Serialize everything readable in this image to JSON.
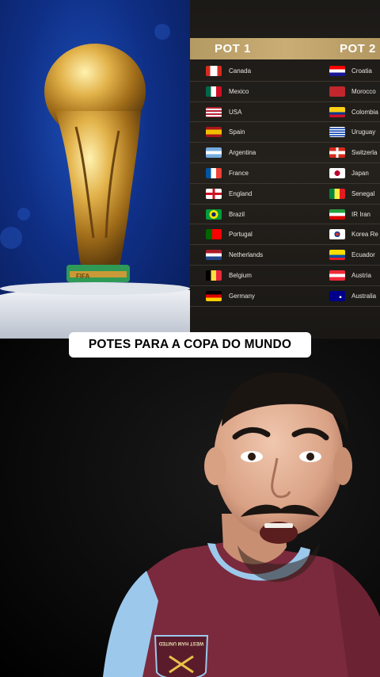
{
  "caption": "POTES PARA A COPA DO MUNDO",
  "pots": {
    "pot1_title": "POT 1",
    "pot2_title": "POT 2",
    "pot1": [
      {
        "name": "Canada",
        "flag": "canada-flag-icon"
      },
      {
        "name": "Mexico",
        "flag": "mexico-flag-icon"
      },
      {
        "name": "USA",
        "flag": "usa-flag-icon"
      },
      {
        "name": "Spain",
        "flag": "spain-flag-icon"
      },
      {
        "name": "Argentina",
        "flag": "argentina-flag-icon"
      },
      {
        "name": "France",
        "flag": "france-flag-icon"
      },
      {
        "name": "England",
        "flag": "england-flag-icon"
      },
      {
        "name": "Brazil",
        "flag": "brazil-flag-icon"
      },
      {
        "name": "Portugal",
        "flag": "portugal-flag-icon"
      },
      {
        "name": "Netherlands",
        "flag": "netherlands-flag-icon"
      },
      {
        "name": "Belgium",
        "flag": "belgium-flag-icon"
      },
      {
        "name": "Germany",
        "flag": "germany-flag-icon"
      }
    ],
    "pot2": [
      {
        "name": "Croatia",
        "flag": "croatia-flag-icon"
      },
      {
        "name": "Morocco",
        "flag": "morocco-flag-icon"
      },
      {
        "name": "Colombia",
        "flag": "colombia-flag-icon"
      },
      {
        "name": "Uruguay",
        "flag": "uruguay-flag-icon"
      },
      {
        "name": "Switzerla",
        "flag": "switzerland-flag-icon"
      },
      {
        "name": "Japan",
        "flag": "japan-flag-icon"
      },
      {
        "name": "Senegal",
        "flag": "senegal-flag-icon"
      },
      {
        "name": "IR Iran",
        "flag": "iran-flag-icon"
      },
      {
        "name": "Korea Re",
        "flag": "korea-flag-icon"
      },
      {
        "name": "Ecuador",
        "flag": "ecuador-flag-icon"
      },
      {
        "name": "Austria",
        "flag": "austria-flag-icon"
      },
      {
        "name": "Australia",
        "flag": "australia-flag-icon"
      }
    ]
  },
  "trophy_base_text": "FIFA",
  "jersey_badge_text": "WEST HAM UNITED",
  "colors": {
    "header_gold": "#c2a66c",
    "panel_bg": "#201e1a",
    "trophy_blue": "#0f2f86",
    "jersey_claret": "#7a2a3c",
    "jersey_sky": "#9cc8ec"
  }
}
